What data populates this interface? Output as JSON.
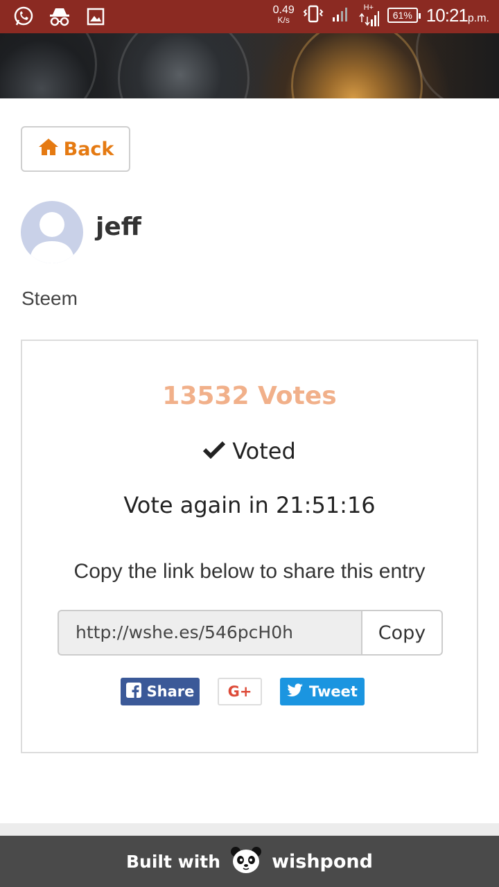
{
  "status_bar": {
    "net_speed_value": "0.49",
    "net_speed_unit": "K/s",
    "network_type": "H+",
    "battery": "61%",
    "time": "10:21",
    "ampm": "p.m."
  },
  "nav": {
    "back_label": "Back"
  },
  "profile": {
    "username": "jeff",
    "community": "Steem"
  },
  "card": {
    "votes": "13532 Votes",
    "voted_label": "Voted",
    "vote_again": "Vote again in 21:51:16",
    "share_caption": "Copy the link below to share this entry",
    "share_link": "http://wshe.es/546pcH0h",
    "copy_label": "Copy"
  },
  "social": {
    "facebook_label": "Share",
    "google_label": "G+",
    "twitter_label": "Tweet"
  },
  "footer": {
    "built_with": "Built with",
    "brand": "wishpond"
  },
  "colors": {
    "status_bar": "#8b2a22",
    "accent_orange": "#e57a12",
    "votes_text": "#f1b08a",
    "facebook": "#3b5998",
    "twitter": "#1b95e0",
    "footer": "#4a4a4a"
  },
  "icons": [
    "whatsapp-icon",
    "incognito-icon",
    "gallery-icon",
    "vibrate-icon",
    "signal-icon",
    "home-icon",
    "check-icon",
    "facebook-icon",
    "twitter-icon",
    "panda-icon"
  ]
}
